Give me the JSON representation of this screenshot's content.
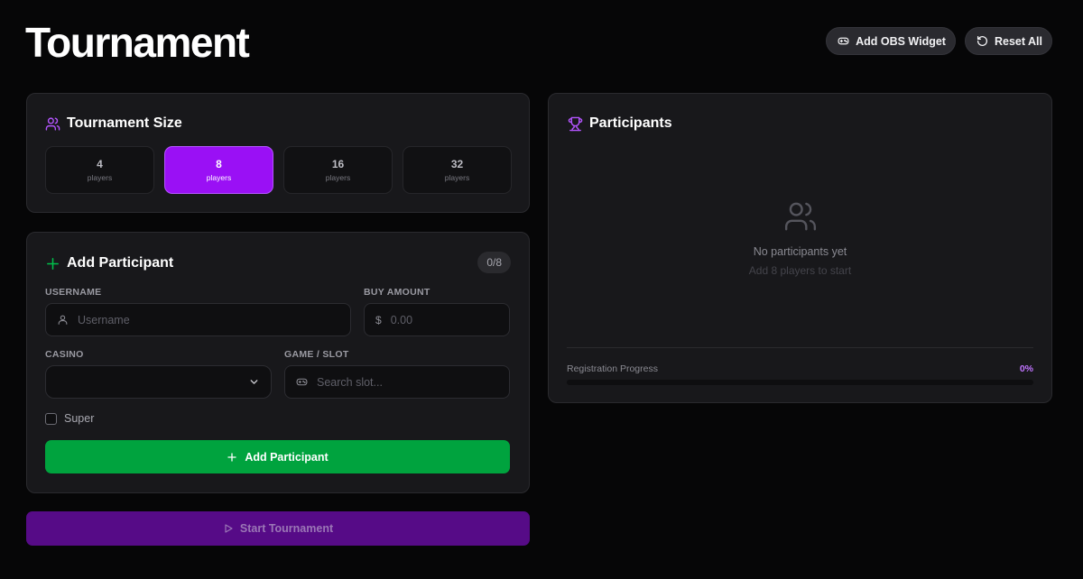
{
  "header": {
    "title": "Tournament",
    "obs_label": "Add OBS Widget",
    "reset_label": "Reset All"
  },
  "size_card": {
    "title": "Tournament Size",
    "options": [
      {
        "value": "4",
        "unit": "players"
      },
      {
        "value": "8",
        "unit": "players"
      },
      {
        "value": "16",
        "unit": "players"
      },
      {
        "value": "32",
        "unit": "players"
      }
    ],
    "selected_value": "8"
  },
  "add_card": {
    "title": "Add Participant",
    "count": "0/8",
    "username_label": "USERNAME",
    "username_placeholder": "Username",
    "buy_label": "BUY AMOUNT",
    "buy_currency": "$",
    "buy_placeholder": "0.00",
    "casino_label": "CASINO",
    "casino_value": "",
    "game_label": "GAME / SLOT",
    "game_placeholder": "Search slot...",
    "super_label": "Super",
    "super_checked": false,
    "submit_label": "Add Participant"
  },
  "start_label": "Start Tournament",
  "participants_card": {
    "title": "Participants",
    "empty_title": "No participants yet",
    "empty_subtitle": "Add 8 players to start",
    "progress_label": "Registration Progress",
    "progress_text": "0%",
    "progress_fraction": 0
  },
  "colors": {
    "accent_purple": "#9a10f5",
    "accent_green": "#00a33e",
    "start_button": "#560b87",
    "background": "#060607",
    "card": "#18181b"
  }
}
